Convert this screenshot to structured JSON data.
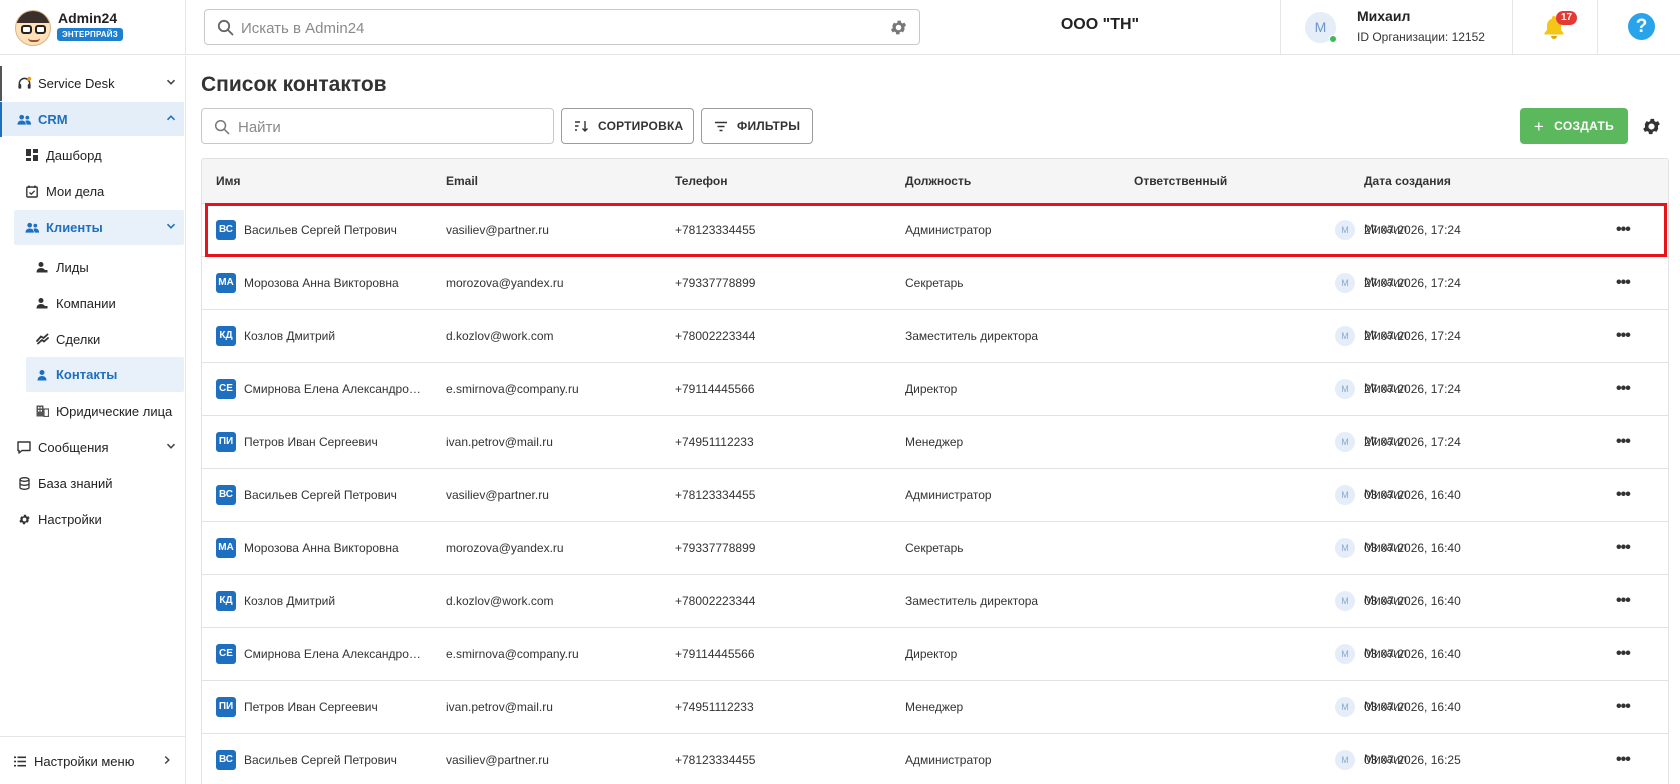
{
  "brand": {
    "name": "Admin24",
    "edition": "ЭНТЕРПРАЙЗ"
  },
  "topbar": {
    "search_placeholder": "Искать в Admin24",
    "org_name": "ООО \"ТН\"",
    "user": {
      "initial": "М",
      "name": "Михаил",
      "org_id": "ID Организации: 12152"
    },
    "notifications_count": "17",
    "help_label": "?"
  },
  "sidebar": {
    "items": [
      {
        "label": "Service Desk"
      },
      {
        "label": "CRM"
      },
      {
        "label": "Дашборд"
      },
      {
        "label": "Мои дела"
      },
      {
        "label": "Клиенты"
      },
      {
        "label": "Лиды"
      },
      {
        "label": "Компании"
      },
      {
        "label": "Сделки"
      },
      {
        "label": "Контакты"
      },
      {
        "label": "Юридические лица"
      },
      {
        "label": "Сообщения"
      },
      {
        "label": "База знаний"
      },
      {
        "label": "Настройки"
      }
    ],
    "bottom_label": "Настройки меню"
  },
  "main": {
    "title": "Список контактов",
    "search_placeholder": "Найти",
    "sort_label": "СОРТИРОВКА",
    "filter_label": "ФИЛЬТРЫ",
    "create_label": "СОЗДАТЬ"
  },
  "table": {
    "columns": [
      "Имя",
      "Email",
      "Телефон",
      "Должность",
      "Ответственный",
      "Дата создания"
    ],
    "rows": [
      {
        "initials": "ВС",
        "name": "Васильев Сергей Петрович",
        "email": "vasiliev@partner.ru",
        "phone": "+78123334455",
        "position": "Администратор",
        "resp_initial": "М",
        "resp": "Михаил",
        "date": "27.07.2026, 17:24"
      },
      {
        "initials": "МА",
        "name": "Морозова Анна Викторовна",
        "email": "morozova@yandex.ru",
        "phone": "+79337778899",
        "position": "Секретарь",
        "resp_initial": "М",
        "resp": "Михаил",
        "date": "27.07.2026, 17:24"
      },
      {
        "initials": "КД",
        "name": "Козлов Дмитрий",
        "email": "d.kozlov@work.com",
        "phone": "+78002223344",
        "position": "Заместитель директора",
        "resp_initial": "М",
        "resp": "Михаил",
        "date": "27.07.2026, 17:24"
      },
      {
        "initials": "СЕ",
        "name": "Смирнова Елена Александровна",
        "email": "e.smirnova@company.ru",
        "phone": "+79114445566",
        "position": "Директор",
        "resp_initial": "М",
        "resp": "Михаил",
        "date": "27.07.2026, 17:24"
      },
      {
        "initials": "ПИ",
        "name": "Петров Иван Сергеевич",
        "email": "ivan.petrov@mail.ru",
        "phone": "+74951112233",
        "position": "Менеджер",
        "resp_initial": "М",
        "resp": "Михаил",
        "date": "27.07.2026, 17:24"
      },
      {
        "initials": "ВС",
        "name": "Васильев Сергей Петрович",
        "email": "vasiliev@partner.ru",
        "phone": "+78123334455",
        "position": "Администратор",
        "resp_initial": "М",
        "resp": "Михаил",
        "date": "03.07.2026, 16:40"
      },
      {
        "initials": "МА",
        "name": "Морозова Анна Викторовна",
        "email": "morozova@yandex.ru",
        "phone": "+79337778899",
        "position": "Секретарь",
        "resp_initial": "М",
        "resp": "Михаил",
        "date": "03.07.2026, 16:40"
      },
      {
        "initials": "КД",
        "name": "Козлов Дмитрий",
        "email": "d.kozlov@work.com",
        "phone": "+78002223344",
        "position": "Заместитель директора",
        "resp_initial": "М",
        "resp": "Михаил",
        "date": "03.07.2026, 16:40"
      },
      {
        "initials": "СЕ",
        "name": "Смирнова Елена Александровна",
        "email": "e.smirnova@company.ru",
        "phone": "+79114445566",
        "position": "Директор",
        "resp_initial": "М",
        "resp": "Михаил",
        "date": "03.07.2026, 16:40"
      },
      {
        "initials": "ПИ",
        "name": "Петров Иван Сергеевич",
        "email": "ivan.petrov@mail.ru",
        "phone": "+74951112233",
        "position": "Менеджер",
        "resp_initial": "М",
        "resp": "Михаил",
        "date": "03.07.2026, 16:40"
      },
      {
        "initials": "ВС",
        "name": "Васильев Сергей Петрович",
        "email": "vasiliev@partner.ru",
        "phone": "+78123334455",
        "position": "Администратор",
        "resp_initial": "М",
        "resp": "Михаил",
        "date": "03.07.2026, 16:25"
      }
    ],
    "more_label": "•••"
  },
  "colors": {
    "accent": "#1e6fc0",
    "create": "#5cb85c",
    "highlight": "#e8121a",
    "badge": "#e53935"
  }
}
